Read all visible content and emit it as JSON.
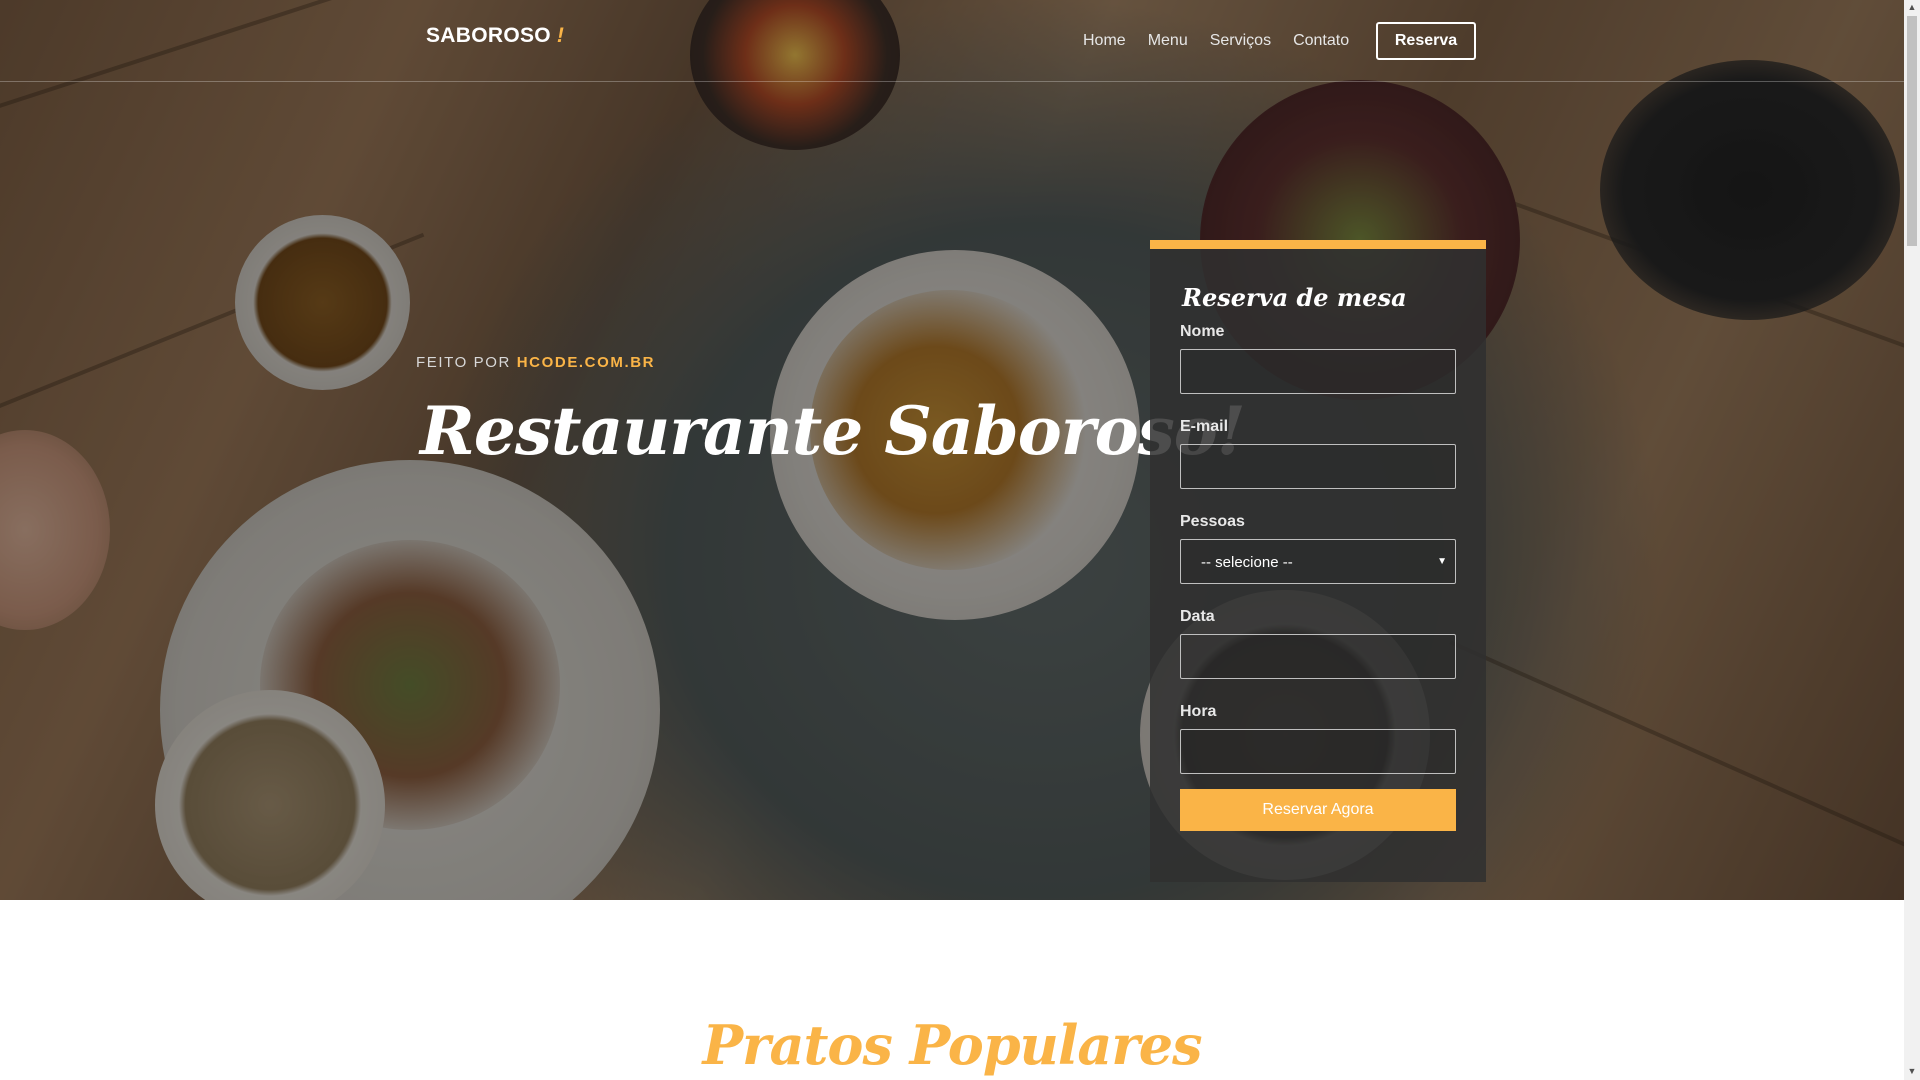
{
  "nav": {
    "brand": "SABOROSO",
    "brand_mark": "!",
    "links": [
      "Home",
      "Menu",
      "Serviços",
      "Contato"
    ],
    "cta": "Reserva"
  },
  "hero": {
    "eyebrow_prefix": "FEITO POR",
    "eyebrow_link": "HCODE.COM.BR",
    "title": "Restaurante Saboroso!"
  },
  "form": {
    "title": "Reserva de mesa",
    "fields": [
      {
        "label": "Nome",
        "value": ""
      },
      {
        "label": "E-mail",
        "value": ""
      },
      {
        "label": "Pessoas",
        "value": "-- selecione --"
      },
      {
        "label": "Data",
        "value": ""
      },
      {
        "label": "Hora",
        "value": ""
      }
    ],
    "submit": "Reservar Agora"
  },
  "section": {
    "title": "Pratos Populares"
  },
  "colors": {
    "accent": "#fab447",
    "form_bg": "#303030"
  }
}
